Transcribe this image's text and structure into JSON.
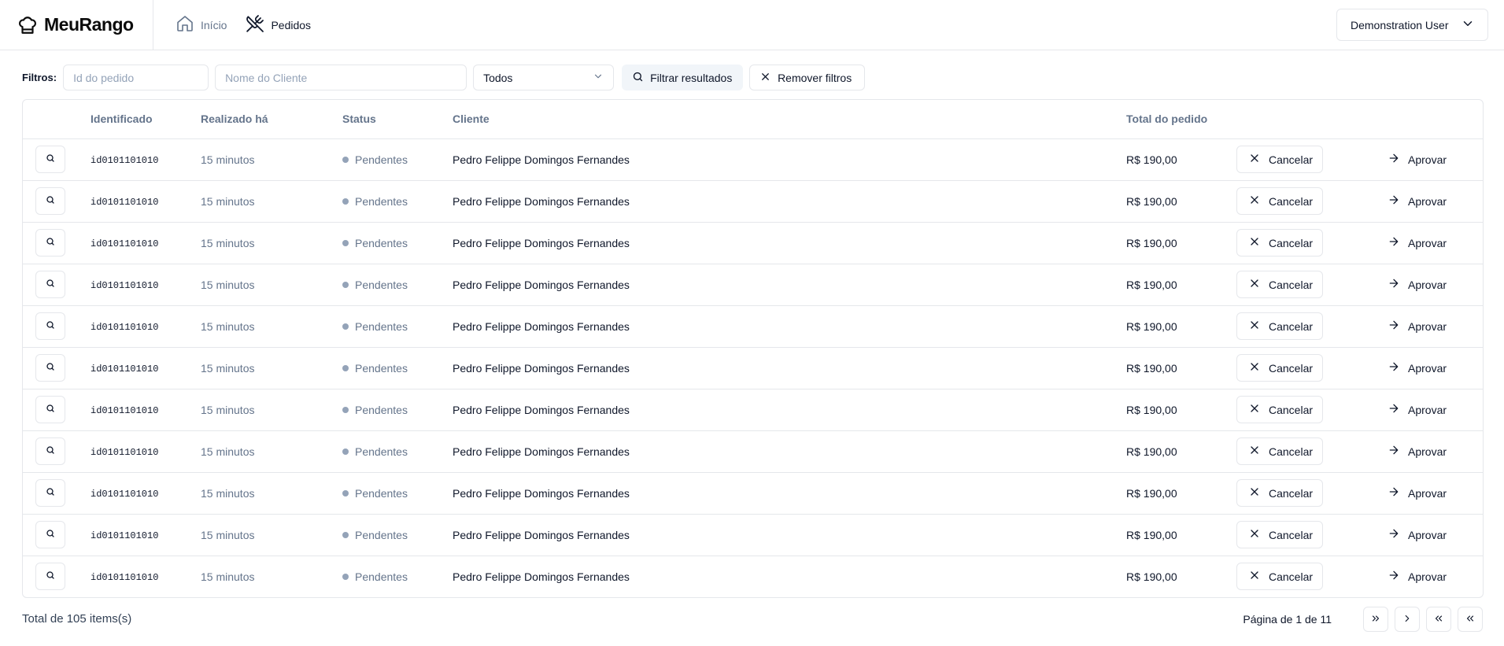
{
  "app": {
    "name": "MeuRango"
  },
  "nav": [
    {
      "label": "Início",
      "icon": "home-icon",
      "state": "muted"
    },
    {
      "label": "Pedidos",
      "icon": "utensils-crossed-icon",
      "state": "active"
    }
  ],
  "user": {
    "name": "Demonstration User"
  },
  "filters": {
    "label": "Filtros:",
    "order_id_placeholder": "Id do pedido",
    "client_placeholder": "Nome do Cliente",
    "status_selected": "Todos",
    "filter_button": "Filtrar resultados",
    "clear_button": "Remover filtros"
  },
  "table": {
    "headers": [
      "",
      "Identificado",
      "Realizado há",
      "Status",
      "Cliente",
      "Total do pedido",
      "",
      ""
    ],
    "cancel_label": "Cancelar",
    "approve_label": "Aprovar",
    "rows": [
      {
        "id": "id0101101010",
        "time": "15 minutos",
        "status": "Pendentes",
        "client": "Pedro Felippe Domingos Fernandes",
        "total": "R$ 190,00"
      },
      {
        "id": "id0101101010",
        "time": "15 minutos",
        "status": "Pendentes",
        "client": "Pedro Felippe Domingos Fernandes",
        "total": "R$ 190,00"
      },
      {
        "id": "id0101101010",
        "time": "15 minutos",
        "status": "Pendentes",
        "client": "Pedro Felippe Domingos Fernandes",
        "total": "R$ 190,00"
      },
      {
        "id": "id0101101010",
        "time": "15 minutos",
        "status": "Pendentes",
        "client": "Pedro Felippe Domingos Fernandes",
        "total": "R$ 190,00"
      },
      {
        "id": "id0101101010",
        "time": "15 minutos",
        "status": "Pendentes",
        "client": "Pedro Felippe Domingos Fernandes",
        "total": "R$ 190,00"
      },
      {
        "id": "id0101101010",
        "time": "15 minutos",
        "status": "Pendentes",
        "client": "Pedro Felippe Domingos Fernandes",
        "total": "R$ 190,00"
      },
      {
        "id": "id0101101010",
        "time": "15 minutos",
        "status": "Pendentes",
        "client": "Pedro Felippe Domingos Fernandes",
        "total": "R$ 190,00"
      },
      {
        "id": "id0101101010",
        "time": "15 minutos",
        "status": "Pendentes",
        "client": "Pedro Felippe Domingos Fernandes",
        "total": "R$ 190,00"
      },
      {
        "id": "id0101101010",
        "time": "15 minutos",
        "status": "Pendentes",
        "client": "Pedro Felippe Domingos Fernandes",
        "total": "R$ 190,00"
      },
      {
        "id": "id0101101010",
        "time": "15 minutos",
        "status": "Pendentes",
        "client": "Pedro Felippe Domingos Fernandes",
        "total": "R$ 190,00"
      },
      {
        "id": "id0101101010",
        "time": "15 minutos",
        "status": "Pendentes",
        "client": "Pedro Felippe Domingos Fernandes",
        "total": "R$ 190,00"
      }
    ]
  },
  "footer": {
    "total_text": "Total de 105 items(s)",
    "page_text": "Página de 1 de 11"
  },
  "colors": {
    "border": "#e5e7eb",
    "muted": "#64748b",
    "status_dot": "#94a3b8",
    "secondary_bg": "#f1f5f9"
  }
}
